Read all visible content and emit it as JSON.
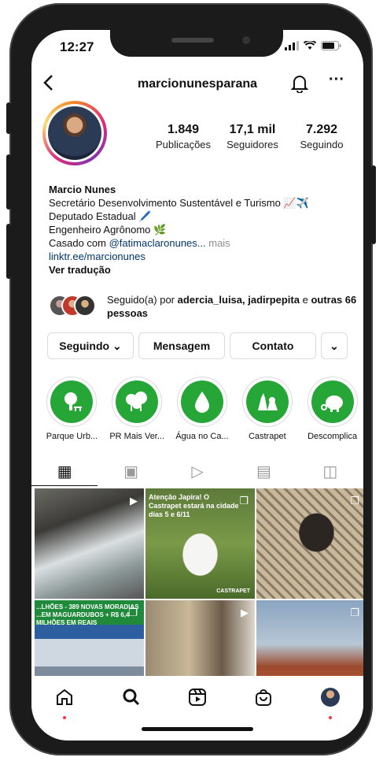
{
  "status_bar": {
    "time": "12:27"
  },
  "header": {
    "username": "marcionunesparana",
    "back_icon": "chevron-left-icon",
    "bell_icon": "bell-icon",
    "more_icon": "more-horizontal-icon"
  },
  "profile": {
    "stats": [
      {
        "value": "1.849",
        "label": "Publicações"
      },
      {
        "value": "17,1 mil",
        "label": "Seguidores"
      },
      {
        "value": "7.292",
        "label": "Seguindo"
      }
    ],
    "name": "Marcio Nunes",
    "bio_lines": [
      "Secretário Desenvolvimento Sustentável e Turismo 📈✈️",
      "Deputado Estadual 🖊️",
      "Engenheiro Agrônomo 🌿"
    ],
    "married_prefix": "Casado com ",
    "married_mention": "@fatimaclaronunes...",
    "more_label": " mais",
    "link": "linktr.ee/marcionunes",
    "translate": "Ver tradução"
  },
  "followed_by": {
    "prefix": "Seguido(a) por ",
    "names": "adercia_luisa, jadirpepita",
    "middle": " e ",
    "others": "outras 66 pessoas"
  },
  "actions": {
    "following": "Seguindo ⌄",
    "message": "Mensagem",
    "contact": "Contato",
    "dropdown": "⌄"
  },
  "highlights": [
    {
      "label": "Parque Urb...",
      "icon": "park-icon"
    },
    {
      "label": "PR Mais Ver...",
      "icon": "trees-icon"
    },
    {
      "label": "Água no Ca...",
      "icon": "water-drop-icon"
    },
    {
      "label": "Castrapet",
      "icon": "pets-icon"
    },
    {
      "label": "Descomplica",
      "icon": "piggy-bank-icon"
    }
  ],
  "tabs": [
    {
      "icon": "grid-icon",
      "glyph": "▦"
    },
    {
      "icon": "reels-icon",
      "glyph": "▣"
    },
    {
      "icon": "video-icon",
      "glyph": "▷"
    },
    {
      "icon": "guide-icon",
      "glyph": "▤"
    },
    {
      "icon": "tagged-icon",
      "glyph": "◫"
    }
  ],
  "posts": {
    "p2_caption": "Atenção Japira! O Castrapet estará na cidade dias 5 e 6/11",
    "p2_logo": "CASTRAPET",
    "p4_caption": "...LHÕES - 389 NOVAS MORADIAS ...EM MAGUARDUBOS + R$ 6,4 MILHÕES EM REAIS"
  },
  "bottom_nav": [
    {
      "icon": "home-icon",
      "glyph": "⌂"
    },
    {
      "icon": "search-icon",
      "glyph": "⚲"
    },
    {
      "icon": "reels-nav-icon",
      "glyph": "▣"
    },
    {
      "icon": "shop-icon",
      "glyph": "⊡"
    },
    {
      "icon": "profile-avatar-icon",
      "glyph": "●"
    }
  ]
}
